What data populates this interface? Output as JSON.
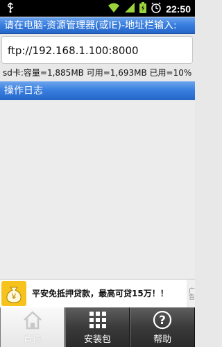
{
  "status_bar": {
    "time": "22:50",
    "icons": [
      "usb-icon",
      "wifi-icon",
      "signal-icon",
      "battery-icon",
      "alarm-icon"
    ]
  },
  "header": {
    "hint": "请在电脑-资源管理器(或IE)-地址栏输入:"
  },
  "ftp_address": "ftp://192.168.1.100:8000",
  "sd_info": "sd卡:容量=1,885MB 可用=1,693MB 已用=10%",
  "log_section": {
    "title": "操作日志"
  },
  "ad": {
    "text": "平安免抵押贷款，最高可贷15万！！",
    "tag": "广告"
  },
  "tabs": [
    {
      "label": "首页",
      "icon": "home-icon",
      "active": true
    },
    {
      "label": "安装包",
      "icon": "grid-icon",
      "active": false
    },
    {
      "label": "帮助",
      "icon": "help-icon",
      "active": false
    }
  ],
  "colors": {
    "accent": "#3a7fdf",
    "statusbar": "#000000",
    "background": "#e8e8e8"
  }
}
